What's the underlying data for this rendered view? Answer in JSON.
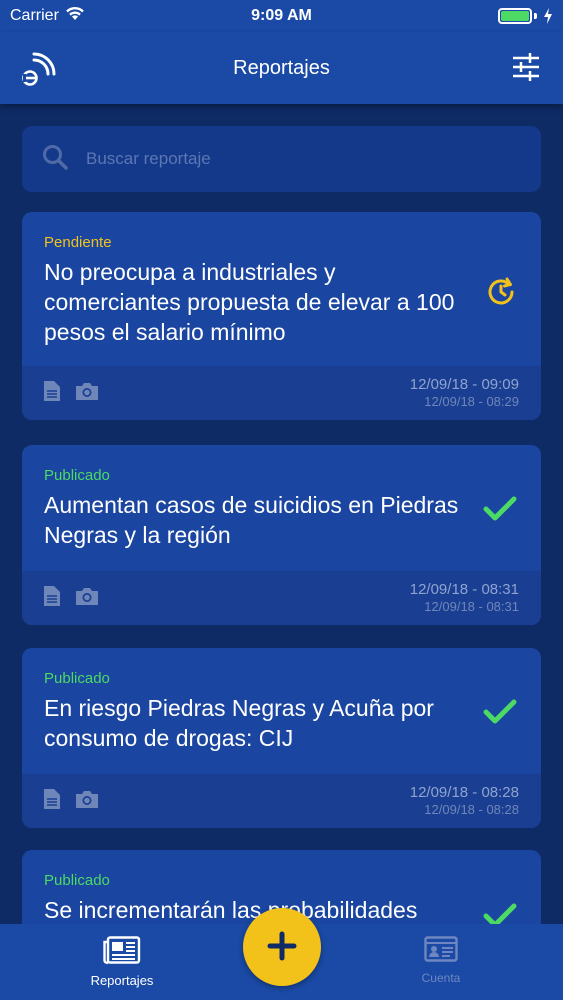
{
  "status_bar": {
    "carrier": "Carrier",
    "time": "9:09 AM"
  },
  "nav": {
    "title": "Reportajes",
    "left_icon": "rss-feed-icon",
    "right_icon": "sliders-icon"
  },
  "search": {
    "placeholder": "Buscar reportaje"
  },
  "reports": [
    {
      "status": "Pendiente",
      "status_type": "pending",
      "title": "No preocupa a industriales y comerciantes propuesta de elevar a 100 pesos el salario mínimo",
      "date_main": "12/09/18 - 09:09",
      "date_sub": "12/09/18 - 08:29",
      "state_icon": "pending-clock-icon"
    },
    {
      "status": "Publicado",
      "status_type": "published",
      "title": "Aumentan casos de suicidios en Piedras Negras y la región",
      "date_main": "12/09/18 - 08:31",
      "date_sub": "12/09/18 - 08:31",
      "state_icon": "checkmark-icon"
    },
    {
      "status": "Publicado",
      "status_type": "published",
      "title": "En riesgo Piedras Negras y Acuña por consumo de drogas: CIJ",
      "date_main": "12/09/18 - 08:28",
      "date_sub": "12/09/18 - 08:28",
      "state_icon": "checkmark-icon"
    },
    {
      "status": "Publicado",
      "status_type": "published",
      "title": "Se incrementarán las probabilidades",
      "date_main": "",
      "date_sub": "",
      "state_icon": "checkmark-icon"
    }
  ],
  "tab_bar": {
    "tabs": [
      {
        "label": "Reportajes",
        "icon": "newspaper-icon",
        "active": true
      },
      {
        "label": "Cuenta",
        "icon": "id-card-icon",
        "active": false
      }
    ],
    "fab_icon": "plus-icon"
  },
  "colors": {
    "background": "#0e2b66",
    "bar": "#1a4aa6",
    "card": "#1a45a0",
    "accent_yellow": "#f2c21b",
    "published_green": "#4cd964"
  }
}
